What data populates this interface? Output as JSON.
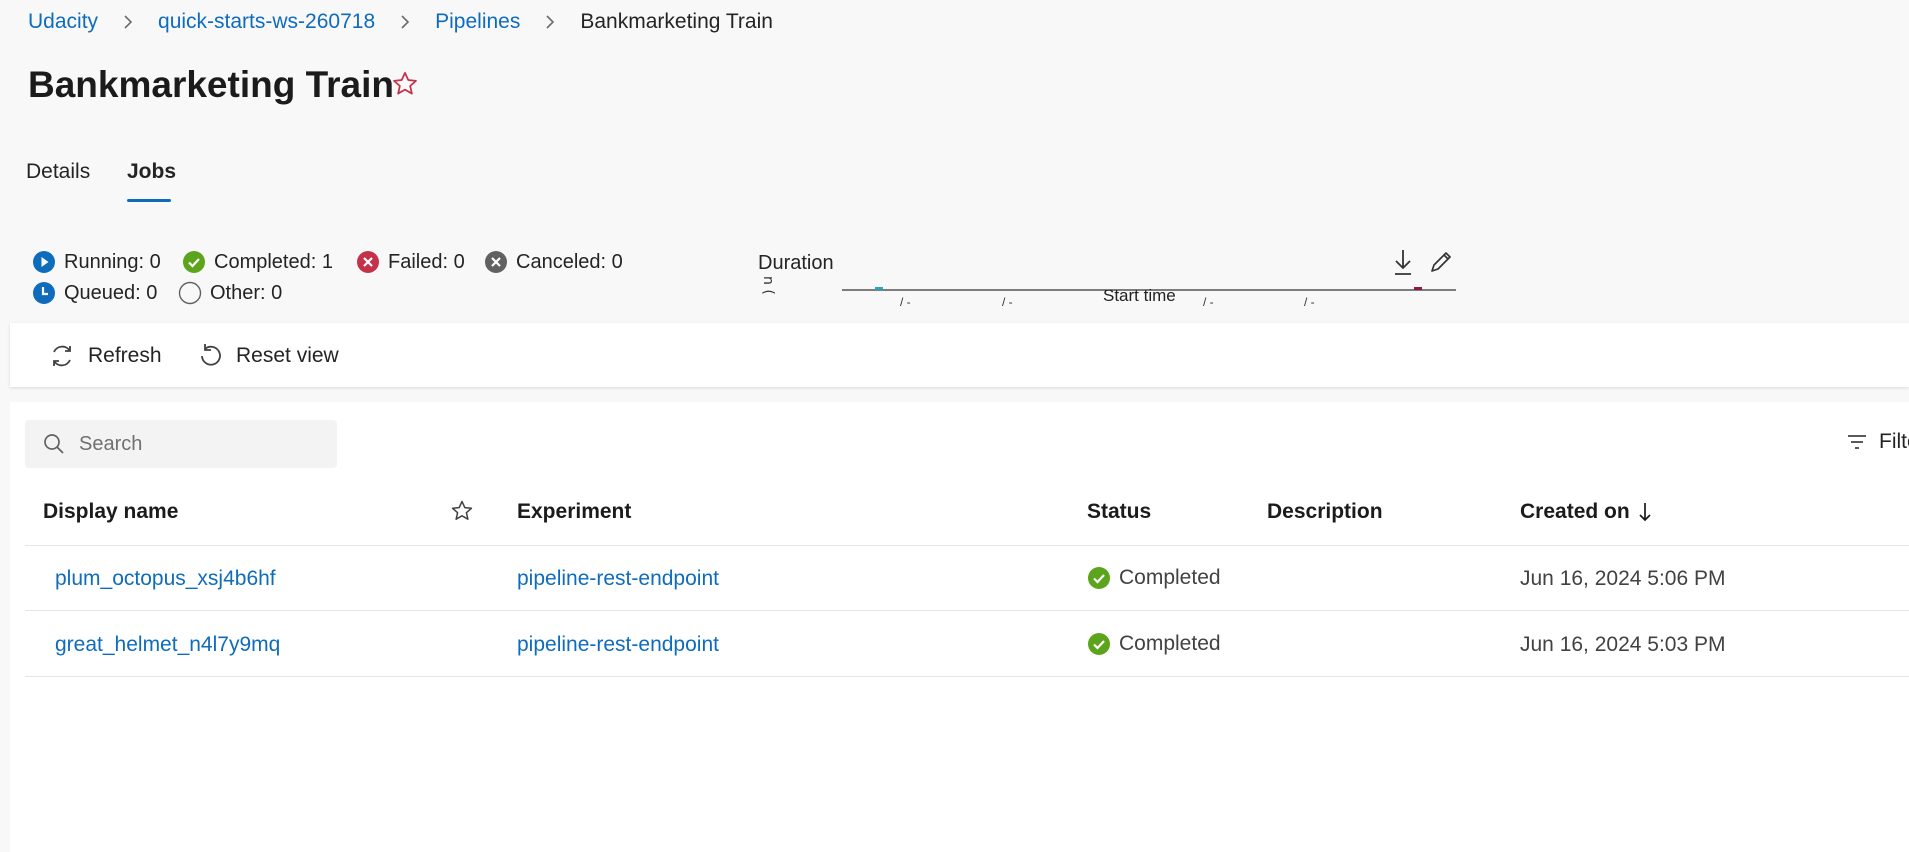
{
  "breadcrumb": {
    "items": [
      "Udacity",
      "quick-starts-ws-260718",
      "Pipelines"
    ],
    "current": "Bankmarketing Train"
  },
  "page": {
    "title": "Bankmarketing Train"
  },
  "tabs": [
    {
      "label": "Details",
      "active": false
    },
    {
      "label": "Jobs",
      "active": true
    }
  ],
  "status_counts": {
    "running": "Running: 0",
    "completed": "Completed: 1",
    "failed": "Failed: 0",
    "canceled": "Canceled: 0",
    "queued": "Queued: 0",
    "other": "Other: 0"
  },
  "duration_chart": {
    "title": "Duration",
    "xlabel": "Start time"
  },
  "toolbar": {
    "refresh_label": "Refresh",
    "reset_label": "Reset view"
  },
  "search": {
    "placeholder": "Search"
  },
  "filter": {
    "label": "Filter"
  },
  "table": {
    "headers": {
      "display_name": "Display name",
      "experiment": "Experiment",
      "status": "Status",
      "description": "Description",
      "created_on": "Created on"
    },
    "rows": [
      {
        "display_name": "plum_octopus_xsj4b6hf",
        "experiment": "pipeline-rest-endpoint",
        "status": "Completed",
        "description": "",
        "created_on": "Jun 16, 2024 5:06 PM"
      },
      {
        "display_name": "great_helmet_n4l7y9mq",
        "experiment": "pipeline-rest-endpoint",
        "status": "Completed",
        "description": "",
        "created_on": "Jun 16, 2024 5:03 PM"
      }
    ]
  },
  "colors": {
    "accent": "#0f6cbd",
    "running": "#0f6cbd",
    "completed": "#5ba41b",
    "failed": "#c4314b",
    "canceled": "#616161",
    "favorite": "#c4314b"
  },
  "icons": [
    "chevron-right-icon",
    "star-outline-icon",
    "running-icon",
    "check-circle-icon",
    "failed-icon",
    "canceled-icon",
    "queued-icon",
    "other-icon",
    "download-icon",
    "edit-icon",
    "refresh-icon",
    "reset-icon",
    "search-icon",
    "filter-icon",
    "sort-down-icon"
  ]
}
